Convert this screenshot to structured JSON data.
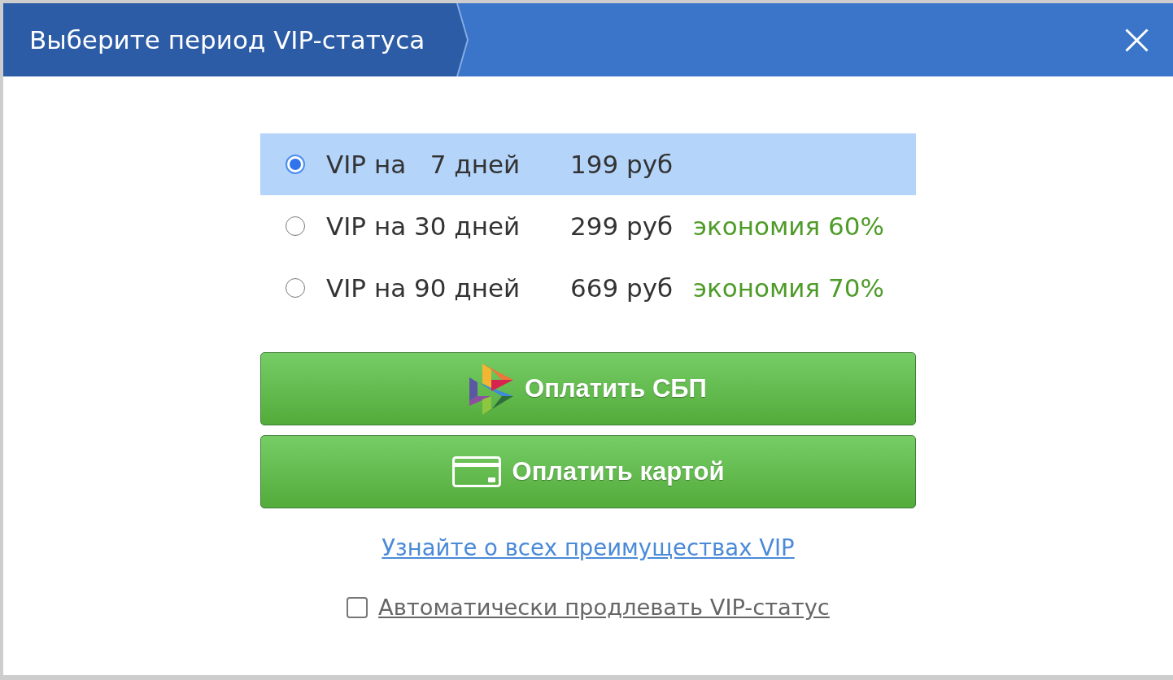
{
  "dialog": {
    "title": "Выберите период VIP-статуса"
  },
  "options": [
    {
      "period": "VIP на   7 дней",
      "price": "199 руб",
      "selected": true
    },
    {
      "period": "VIP на 30 дней",
      "price": "299 руб",
      "saving": "экономия 60%",
      "selected": false
    },
    {
      "period": "VIP на 90 дней",
      "price": "669 руб",
      "saving": "экономия 70%",
      "selected": false
    }
  ],
  "buttons": [
    {
      "kind": "sbp",
      "label": "Оплатить СБП"
    },
    {
      "kind": "card",
      "label": "Оплатить картой"
    }
  ],
  "link": "Узнайте о всех преимуществах VIP",
  "auto_renew": {
    "label": "Автоматически продлевать VIP-статус",
    "checked": false
  }
}
